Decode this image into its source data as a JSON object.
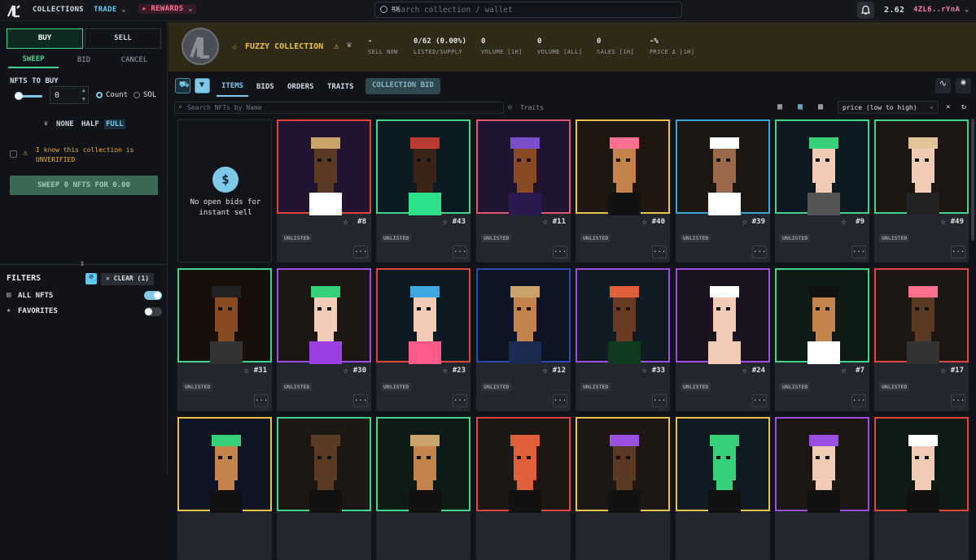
{
  "topbar": {
    "collections": "COLLECTIONS",
    "trade": "TRADE",
    "rewards": "REWARDS",
    "search_placeholder": "Search collection / wallet",
    "shortcut": "⌘K",
    "balance": "2.62",
    "wallet": "4ZL6..rYnA"
  },
  "left": {
    "buy": "BUY",
    "sell": "SELL",
    "sweep": "SWEEP",
    "bid": "BID",
    "cancel": "CANCEL",
    "nfts_to_buy": "NFTS TO BUY",
    "qty": "0",
    "count": "Count",
    "sol": "SOL",
    "none": "NONE",
    "half": "HALF",
    "full": "FULL",
    "unverified": "I know this collection is UNVERIFIED",
    "sweep_btn": "SWEEP 0 NFTS FOR 0.00",
    "filters": "FILTERS",
    "clear": "CLEAR (1)",
    "all_nfts": "ALL NFTS",
    "favorites": "FAVORITES"
  },
  "header": {
    "name": "FUZZY COLLECTION",
    "stats": [
      {
        "v": "-",
        "l": "SELL NOW"
      },
      {
        "v": "0/62 (0.00%)",
        "l": "LISTED/SUPPLY"
      },
      {
        "v": "0",
        "l": "VOLUME [1H]"
      },
      {
        "v": "0",
        "l": "VOLUME [ALL]"
      },
      {
        "v": "0",
        "l": "SALES [1H]"
      },
      {
        "v": "-%",
        "l": "PRICE Δ [1H]"
      }
    ]
  },
  "tabs": {
    "items": "ITEMS",
    "bids": "BIDS",
    "orders": "ORDERS",
    "traits": "TRAITS",
    "collection_bid": "COLLECTION BID"
  },
  "toolbar": {
    "search_placeholder": "Search NFTs by Name",
    "traits": "Traits",
    "sort": "price (low to high)"
  },
  "bidcard": {
    "text": "No open bids for instant sell"
  },
  "items": [
    {
      "num": "#8",
      "color": "#e0443f",
      "bg": "#221430",
      "hat": "#c9a36a",
      "skin": "#5a3a22",
      "shirt": "#ffffff"
    },
    {
      "num": "#43",
      "color": "#3fd48e",
      "bg": "#0c1a22",
      "hat": "#b83b34",
      "skin": "#3b2416",
      "shirt": "#2fe08a"
    },
    {
      "num": "#11",
      "color": "#e0556f",
      "bg": "#1f1430",
      "hat": "#7b4fc9",
      "skin": "#8a4a24",
      "shirt": "#2a1a50"
    },
    {
      "num": "#40",
      "color": "#e8c34a",
      "bg": "#1f1610",
      "hat": "#ff6f90",
      "skin": "#c4834a",
      "shirt": "#111111"
    },
    {
      "num": "#39",
      "color": "#39a6d8",
      "bg": "#1c1712",
      "hat": "#ffffff",
      "skin": "#9a6a4a",
      "shirt": "#ffffff"
    },
    {
      "num": "#9",
      "color": "#3fd48e",
      "bg": "#0e1a22",
      "hat": "#37d07a",
      "skin": "#f2cbb6",
      "shirt": "#555555"
    },
    {
      "num": "#49",
      "color": "#3fd48e",
      "bg": "#1c1712",
      "hat": "#e2c49a",
      "skin": "#f2cbb6",
      "shirt": "#222222"
    },
    {
      "num": "#31",
      "color": "#3fd48e",
      "bg": "#170f0a",
      "hat": "#222222",
      "skin": "#8a4a24",
      "shirt": "#333333"
    },
    {
      "num": "#30",
      "color": "#9b4fe0",
      "bg": "#1c1712",
      "hat": "#37d07a",
      "skin": "#f2cbb6",
      "shirt": "#9a3fe0"
    },
    {
      "num": "#23",
      "color": "#e0443f",
      "bg": "#0e1a22",
      "hat": "#3fa8e0",
      "skin": "#f2cbb6",
      "shirt": "#ff5a8a"
    },
    {
      "num": "#12",
      "color": "#2a4ab0",
      "bg": "#0e1424",
      "hat": "#c9a36a",
      "skin": "#c4834a",
      "shirt": "#1a2a50"
    },
    {
      "num": "#33",
      "color": "#9b4fe0",
      "bg": "#101a22",
      "hat": "#e0603a",
      "skin": "#6a3a22",
      "shirt": "#0e3a20"
    },
    {
      "num": "#24",
      "color": "#9b4fe0",
      "bg": "#1c1320",
      "hat": "#ffffff",
      "skin": "#f2cbb6",
      "shirt": "#f2cbb6"
    },
    {
      "num": "#7",
      "color": "#3fd48e",
      "bg": "#0e1a14",
      "hat": "#111111",
      "skin": "#c4834a",
      "shirt": "#ffffff"
    },
    {
      "num": "#17",
      "color": "#e0443f",
      "bg": "#1c1712",
      "hat": "#ff6f90",
      "skin": "#5a3a22",
      "shirt": "#333333"
    },
    {
      "num": "",
      "color": "#e8c34a",
      "bg": "#0e1424",
      "hat": "#37d07a",
      "skin": "#c4834a",
      "shirt": "#111111"
    },
    {
      "num": "",
      "color": "#3fd48e",
      "bg": "#1c1712",
      "hat": "#5a3a22",
      "skin": "#5a3a22",
      "shirt": "#111111"
    },
    {
      "num": "",
      "color": "#3fd48e",
      "bg": "#0e1a14",
      "hat": "#c9a36a",
      "skin": "#c4834a",
      "shirt": "#111111"
    },
    {
      "num": "",
      "color": "#e0443f",
      "bg": "#1c1712",
      "hat": "#e0603a",
      "skin": "#e0603a",
      "shirt": "#111111"
    },
    {
      "num": "",
      "color": "#e8c34a",
      "bg": "#1c1712",
      "hat": "#9b4fe0",
      "skin": "#5a3a22",
      "shirt": "#111111"
    },
    {
      "num": "",
      "color": "#e8c34a",
      "bg": "#101a22",
      "hat": "#37d07a",
      "skin": "#37d07a",
      "shirt": "#111111"
    },
    {
      "num": "",
      "color": "#9b4fe0",
      "bg": "#1c1712",
      "hat": "#9b4fe0",
      "skin": "#f2cbb6",
      "shirt": "#111111"
    },
    {
      "num": "",
      "color": "#e0443f",
      "bg": "#0e1a14",
      "hat": "#ffffff",
      "skin": "#f2cbb6",
      "shirt": "#111111"
    }
  ],
  "unlisted": "UNLISTED",
  "more": "..."
}
